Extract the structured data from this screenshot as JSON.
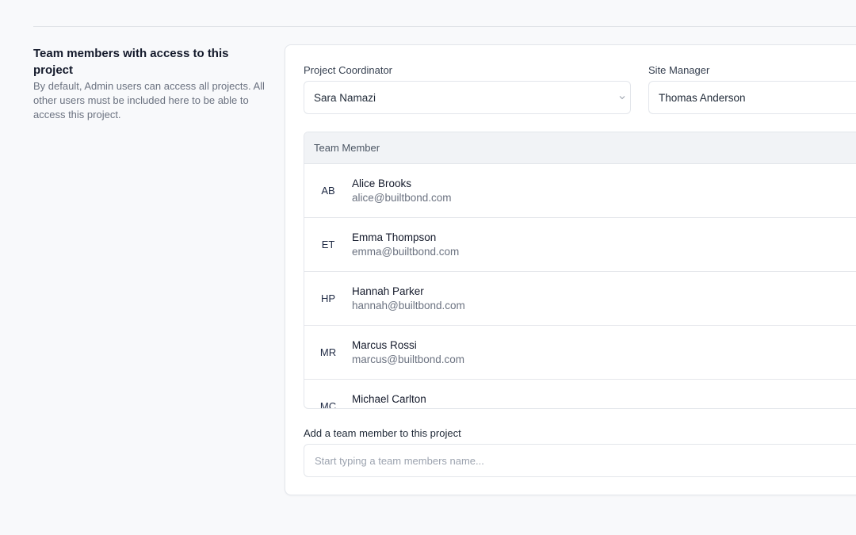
{
  "intro": {
    "title": "Team members with access to this project",
    "description": "By default, Admin users can access all projects. All other users must be included here to be able to access this project."
  },
  "fields": {
    "coordinator": {
      "label": "Project Coordinator",
      "value": "Sara Namazi"
    },
    "site_manager": {
      "label": "Site Manager",
      "value": "Thomas Anderson"
    }
  },
  "table": {
    "header": "Team Member",
    "members": [
      {
        "initials": "AB",
        "name": "Alice Brooks",
        "email": "alice@builtbond.com"
      },
      {
        "initials": "ET",
        "name": "Emma Thompson",
        "email": "emma@builtbond.com"
      },
      {
        "initials": "HP",
        "name": "Hannah Parker",
        "email": "hannah@builtbond.com"
      },
      {
        "initials": "MR",
        "name": "Marcus Rossi",
        "email": "marcus@builtbond.com"
      },
      {
        "initials": "MC",
        "name": "Michael Carlton",
        "email": ""
      }
    ]
  },
  "add_member": {
    "label": "Add a team member to this project",
    "placeholder": "Start typing a team members name..."
  },
  "icons": {
    "select_chevron": "chevron-down-icon"
  },
  "colors": {
    "border": "#e3e6eb",
    "header_bg": "#f1f3f6",
    "page_bg": "#f8f9fb"
  }
}
